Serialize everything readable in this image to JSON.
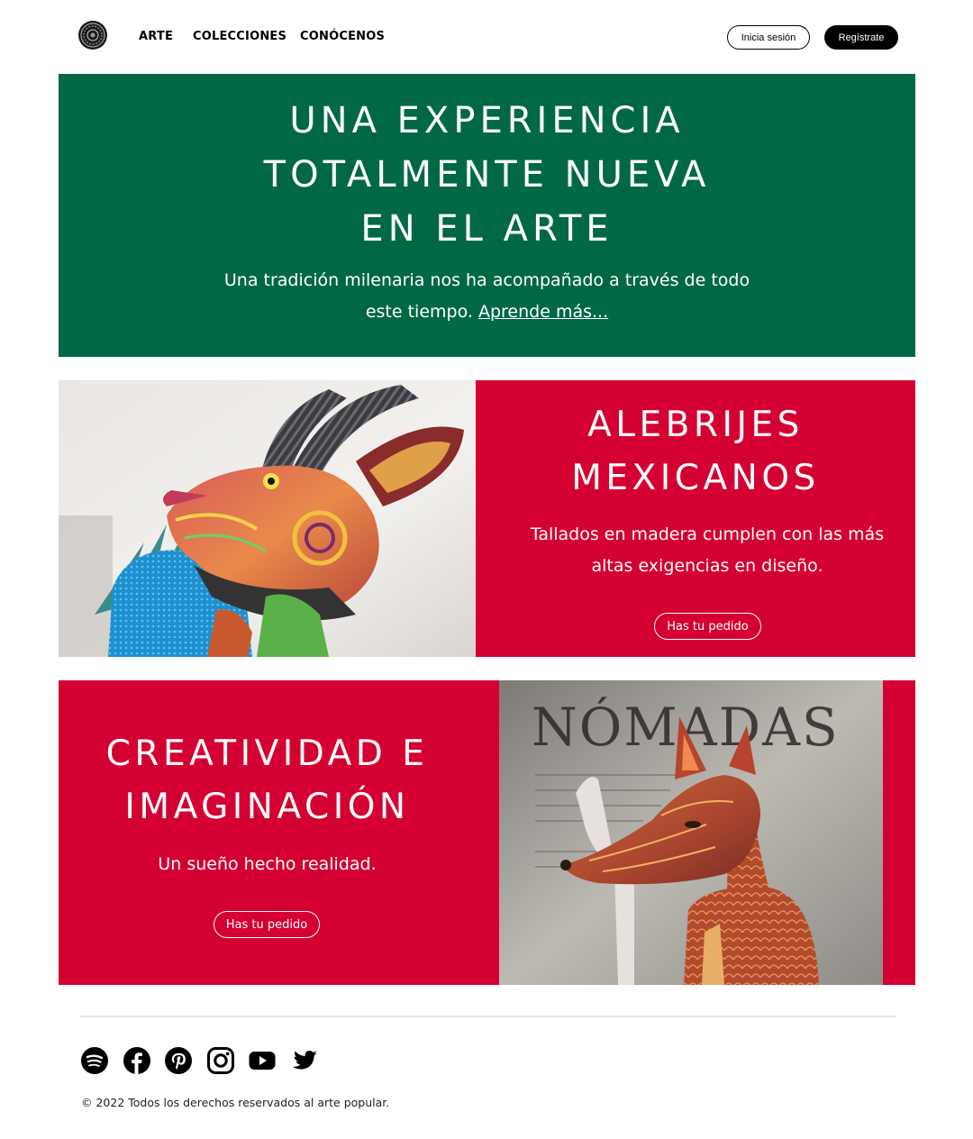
{
  "nav": {
    "links": [
      "ARTE",
      "COLECCIONES",
      "CONÓCENOS"
    ],
    "login_label": "Inicia sesión",
    "register_label": "Regístrate"
  },
  "hero": {
    "title_lines": [
      "UNA EXPERIENCIA",
      "TOTALMENTE NUEVA",
      "EN EL ARTE"
    ],
    "text": "Una tradición milenaria nos ha acompañado a través de todo este tiempo.",
    "link_label": "Aprende más..."
  },
  "alebrijes": {
    "title_lines": [
      "ALEBRIJES",
      "MEXICANOS"
    ],
    "text": "Tallados en madera cumplen con las más altas exigencias en diseño.",
    "button_label": "Has tu pedido"
  },
  "creatividad": {
    "title_lines": [
      "CREATIVIDAD E",
      "IMAGINACIÓN"
    ],
    "text": "Un sueño hecho realidad.",
    "button_label": "Has tu pedido",
    "photo_sign": "NÓMADAS"
  },
  "footer": {
    "social_icons": [
      "spotify-icon",
      "facebook-icon",
      "pinterest-icon",
      "instagram-icon",
      "youtube-icon",
      "twitter-icon"
    ],
    "copyright": "© 2022 Todos los derechos reservados al arte popular."
  },
  "colors": {
    "green": "#006847",
    "red": "#d50032",
    "black": "#000000"
  }
}
